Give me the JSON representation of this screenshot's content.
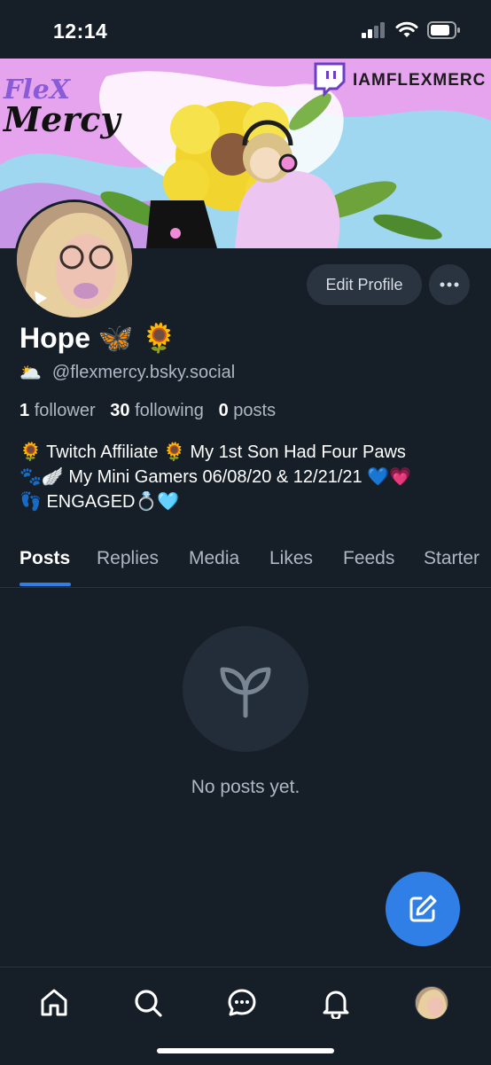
{
  "status_bar": {
    "time": "12:14"
  },
  "banner": {
    "overlay_handle": "IAMFLEXMERC",
    "logo_text": "Flex Mercy"
  },
  "profile": {
    "display_name": "Hope 🦋 🌻",
    "handle_emoji": "🌥️",
    "handle": "@flexmercy.bsky.social",
    "stats": {
      "followers_count": "1",
      "followers_label": "follower",
      "following_count": "30",
      "following_label": "following",
      "posts_count": "0",
      "posts_label": "posts"
    },
    "bio_lines": [
      "🌻 Twitch Affiliate 🌻 My 1st Son Had Four Paws",
      "🐾🪽 My Mini Gamers 06/08/20 & 12/21/21 💙💗",
      "👣 ENGAGED💍🩵"
    ]
  },
  "actions": {
    "edit_profile_label": "Edit Profile",
    "more_label": "•••"
  },
  "tabs": [
    {
      "label": "Posts",
      "active": true
    },
    {
      "label": "Replies",
      "active": false
    },
    {
      "label": "Media",
      "active": false
    },
    {
      "label": "Likes",
      "active": false
    },
    {
      "label": "Feeds",
      "active": false
    },
    {
      "label": "Starter",
      "active": false
    }
  ],
  "empty_state": {
    "icon": "sprout-icon",
    "message": "No posts yet."
  },
  "fab": {
    "icon": "compose-icon"
  },
  "bottom_nav": [
    {
      "name": "home",
      "icon": "home-icon"
    },
    {
      "name": "search",
      "icon": "search-icon"
    },
    {
      "name": "chat",
      "icon": "chat-icon"
    },
    {
      "name": "notifications",
      "icon": "bell-icon"
    },
    {
      "name": "profile",
      "icon": "avatar"
    }
  ],
  "colors": {
    "background": "#161e27",
    "accent": "#2f7fe6",
    "muted_text": "#aeb8c4",
    "button_bg": "#2a3441"
  }
}
